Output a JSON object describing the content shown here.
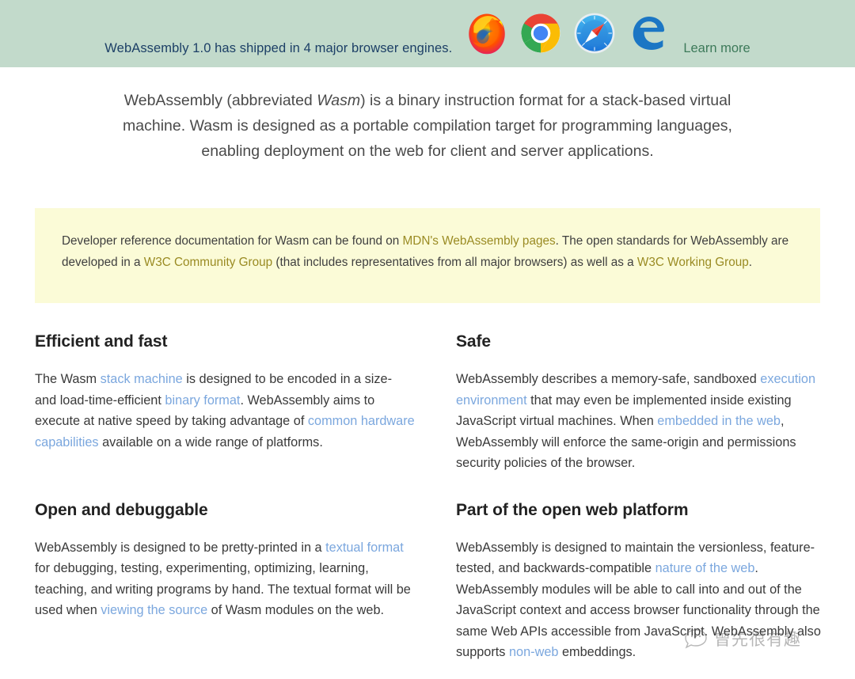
{
  "banner": {
    "message": "WebAssembly 1.0 has shipped in 4 major browser engines.",
    "learn_more_label": "Learn more",
    "background_color": "#c2dacb",
    "text_color": "#1c3f66",
    "link_color": "#3d7a5a",
    "browsers": [
      {
        "name": "firefox-icon",
        "label": "Firefox"
      },
      {
        "name": "chrome-icon",
        "label": "Chrome"
      },
      {
        "name": "safari-icon",
        "label": "Safari"
      },
      {
        "name": "edge-icon",
        "label": "Microsoft Edge"
      }
    ]
  },
  "intro": {
    "part1": "WebAssembly (abbreviated ",
    "emphasis": "Wasm",
    "part2": ") is a binary instruction format for a stack-based virtual machine. Wasm is designed as a portable compilation target for programming languages, enabling deployment on the web for client and server applications."
  },
  "callout": {
    "background_color": "#fbfbd7",
    "link_color": "#9a8b23",
    "t1": "Developer reference documentation for Wasm can be found on ",
    "link1": "MDN's WebAssembly pages",
    "t2": ". The open standards for WebAssembly are developed in a ",
    "link2": "W3C Community Group",
    "t3": " (that includes representatives from all major browsers) as well as a ",
    "link3": "W3C Working Group",
    "t4": "."
  },
  "sections": {
    "link_color": "#7ba7de",
    "efficient": {
      "heading": "Efficient and fast",
      "t1": "The Wasm ",
      "link1": "stack machine",
      "t2": " is designed to be encoded in a size- and load-time-efficient ",
      "link2": "binary format",
      "t3": ". WebAssembly aims to execute at native speed by taking advantage of ",
      "link3": "common hardware capabilities",
      "t4": " available on a wide range of platforms."
    },
    "safe": {
      "heading": "Safe",
      "t1": "WebAssembly describes a memory-safe, sandboxed ",
      "link1": "execution environment",
      "t2": " that may even be implemented inside existing JavaScript virtual machines. When ",
      "link2": "embedded in the web",
      "t3": ", WebAssembly will enforce the same-origin and permissions security policies of the browser."
    },
    "open": {
      "heading": "Open and debuggable",
      "t1": "WebAssembly is designed to be pretty-printed in a ",
      "link1": "textual format",
      "t2": " for debugging, testing, experimenting, optimizing, learning, teaching, and writing programs by hand. The textual format will be used when ",
      "link2": "viewing the source",
      "t3": " of Wasm modules on the web."
    },
    "platform": {
      "heading": "Part of the open web platform",
      "t1": "WebAssembly is designed to maintain the versionless, feature-tested, and backwards-compatible ",
      "link1": "nature of the web",
      "t2": ". WebAssembly modules will be able to call into and out of the JavaScript context and access browser functionality through the same Web APIs accessible from JavaScript. WebAssembly also supports ",
      "link2": "non-web",
      "t3": " embeddings."
    }
  },
  "watermark": {
    "icon": "chat-bubble-face-icon",
    "text": "曾先很有趣"
  }
}
